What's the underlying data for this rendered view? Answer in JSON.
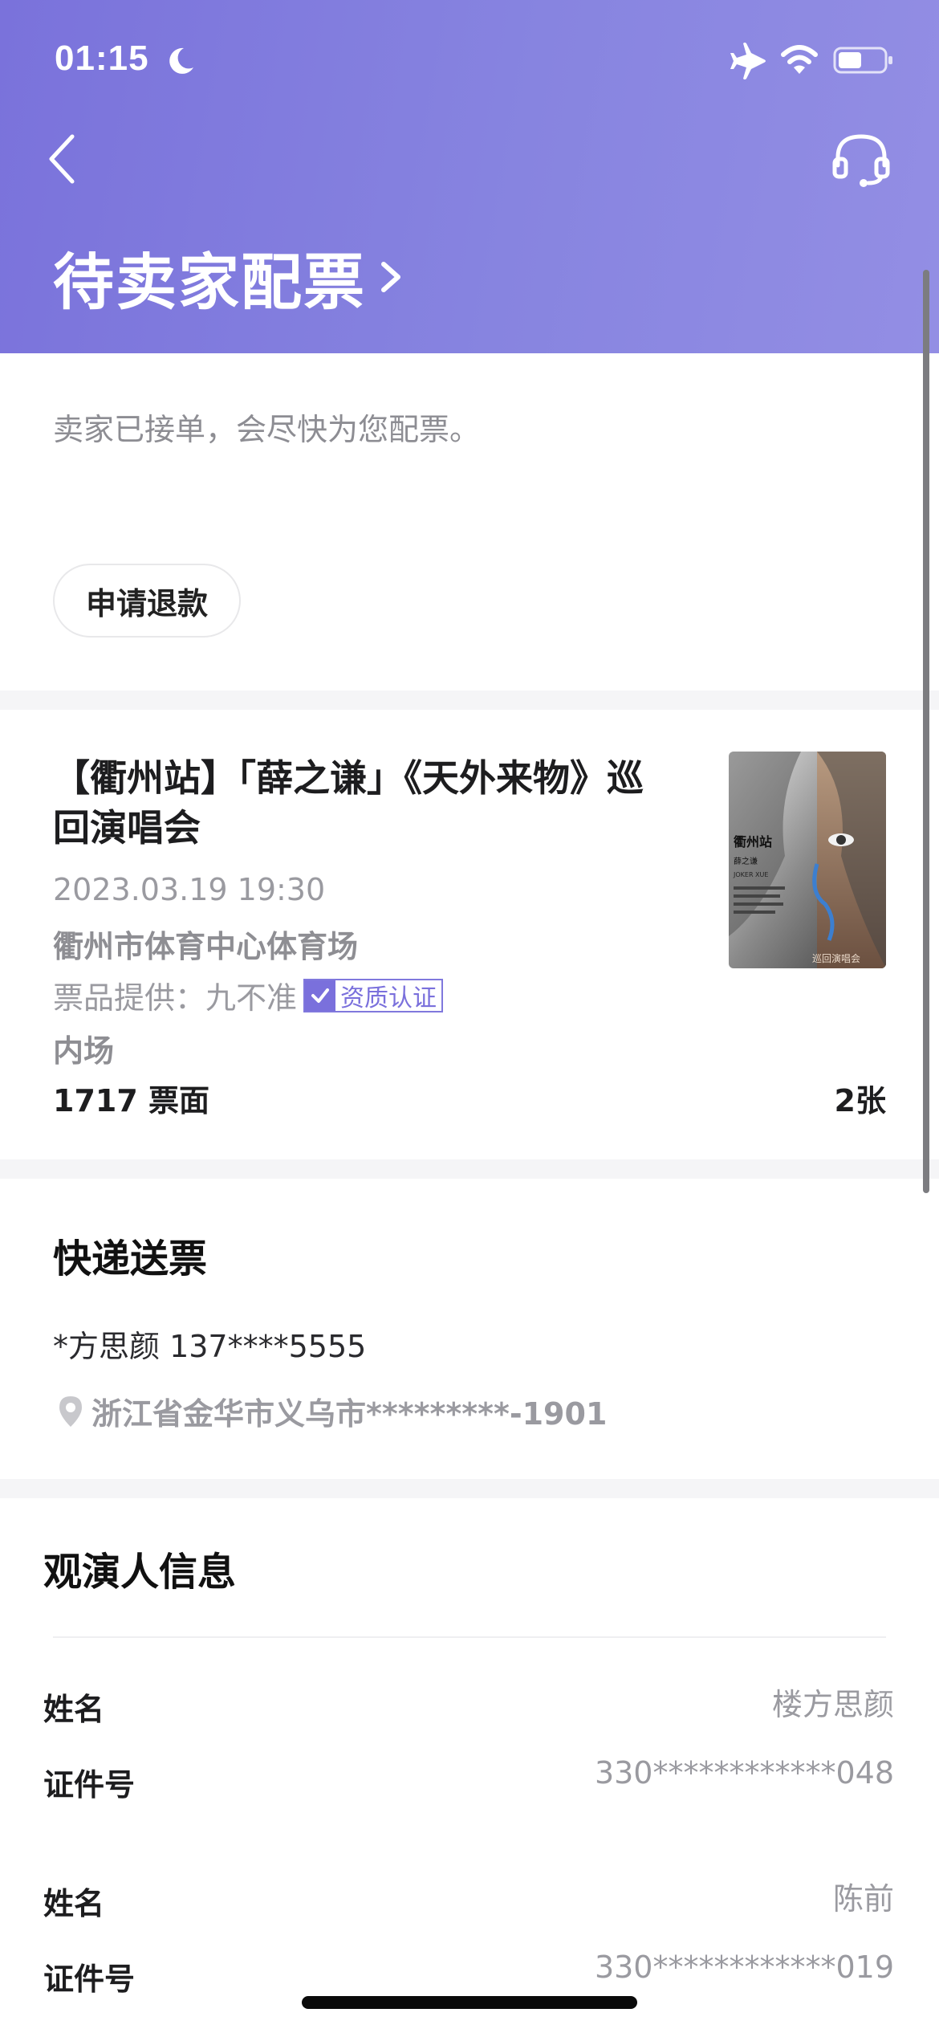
{
  "status_bar": {
    "time": "01:15",
    "icons": [
      "moon-icon",
      "airplane-icon",
      "wifi-icon",
      "battery-icon"
    ]
  },
  "nav": {
    "back_icon": "chevron-left-icon",
    "service_icon": "headset-icon"
  },
  "header": {
    "status_title": "待卖家配票",
    "accent_gradient": [
      "#7a72db",
      "#938ee4"
    ]
  },
  "order_status": {
    "description": "卖家已接单，会尽快为您配票。",
    "refund_button": "申请退款"
  },
  "show": {
    "title": "【衢州站】「薛之谦」《天外来物》巡回演唱会",
    "datetime": "2023.03.19 19:30",
    "venue": "衢州市体育中心体育场",
    "provider_label": "票品提供：",
    "provider_name": "九不准",
    "cert_badge": "资质认证",
    "zone": "内场",
    "price": "1717 票面",
    "quantity": "2张",
    "poster": {
      "title": "衢州站",
      "artist": "薛之谦",
      "tour": "JOKER XUE",
      "subtitle": "巡回演唱会"
    }
  },
  "delivery": {
    "title": "快递送票",
    "contact": "*方思颜 137****5555",
    "address": "浙江省金华市义乌市*********-1901"
  },
  "viewers": {
    "title": "观演人信息",
    "name_label": "姓名",
    "id_label": "证件号",
    "list": [
      {
        "name": "楼方思颜",
        "id": "330************048"
      },
      {
        "name": "陈前",
        "id": "330************019"
      }
    ]
  }
}
